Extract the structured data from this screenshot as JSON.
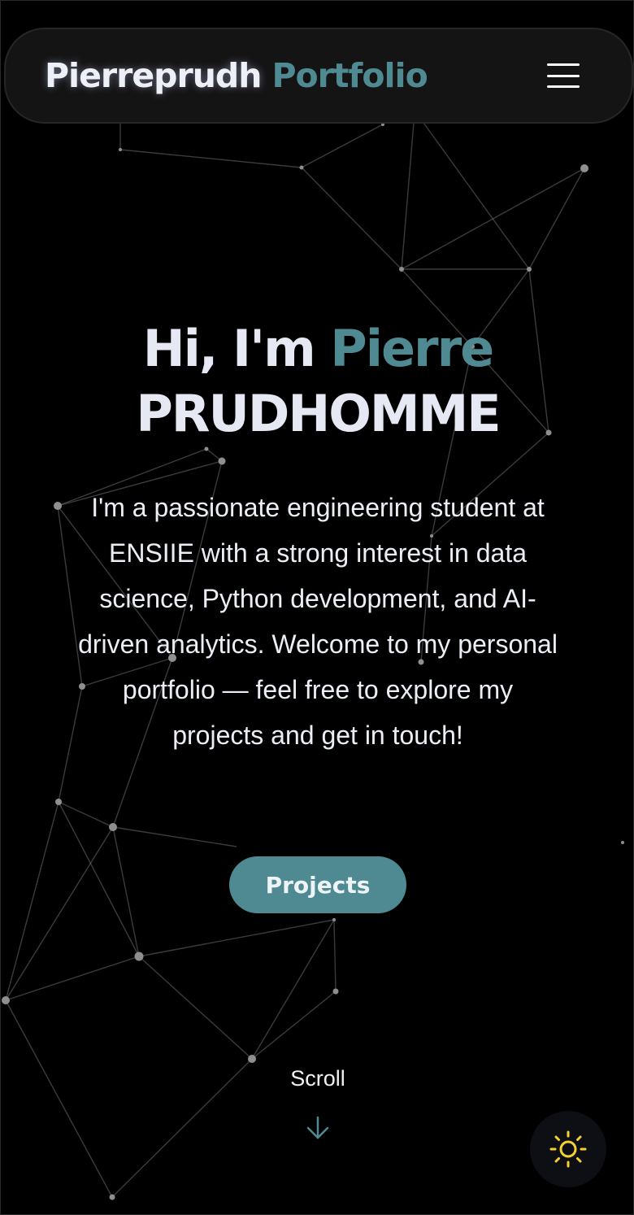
{
  "navbar": {
    "brand_name": "Pierreprudh",
    "brand_accent": "Portfolio",
    "menu_icon": "hamburger-menu-icon"
  },
  "hero": {
    "greeting": "Hi, I'm",
    "first_name": "Pierre",
    "last_name": "PRUDHOMME",
    "description": "I'm a passionate engineering student at ENSIIE with a strong interest in data science, Python development, and AI-driven analytics. Welcome to my personal portfolio — feel free to explore my projects and get in touch!",
    "cta_label": "Projects",
    "scroll_label": "Scroll",
    "scroll_icon": "arrow-down-icon"
  },
  "theme_toggle": {
    "icon": "sun-icon",
    "icon_color": "#f5d130"
  },
  "colors": {
    "background": "#000000",
    "accent": "#4f8a93",
    "text": "#e6e9f3"
  }
}
